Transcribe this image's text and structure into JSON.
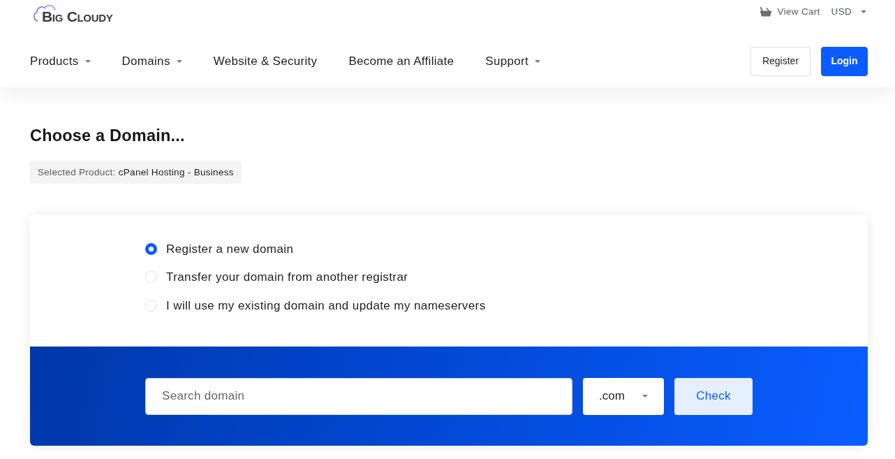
{
  "header": {
    "logo": "Big Cloudy",
    "cart_link": "View Cart",
    "currency": "USD"
  },
  "nav": {
    "items": [
      {
        "label": "Products",
        "dropdown": true
      },
      {
        "label": "Domains",
        "dropdown": true
      },
      {
        "label": "Website & Security",
        "dropdown": false
      },
      {
        "label": "Become an Affiliate",
        "dropdown": false
      },
      {
        "label": "Support",
        "dropdown": true
      }
    ],
    "buttons": [
      {
        "label": "Register",
        "kind": "outline"
      },
      {
        "label": "Login",
        "kind": "primary"
      }
    ]
  },
  "page": {
    "title": "Choose a Domain...",
    "selected_product": {
      "label": "Selected Product:",
      "value": "cPanel Hosting - Business"
    }
  },
  "domain_options": [
    {
      "label": "Register a new domain",
      "selected": true
    },
    {
      "label": "Transfer your domain from another registrar",
      "selected": false
    },
    {
      "label": "I will use my existing domain and update my nameservers",
      "selected": false
    }
  ],
  "search": {
    "placeholder": "Search domain",
    "tld": ".com",
    "button": "Check"
  }
}
